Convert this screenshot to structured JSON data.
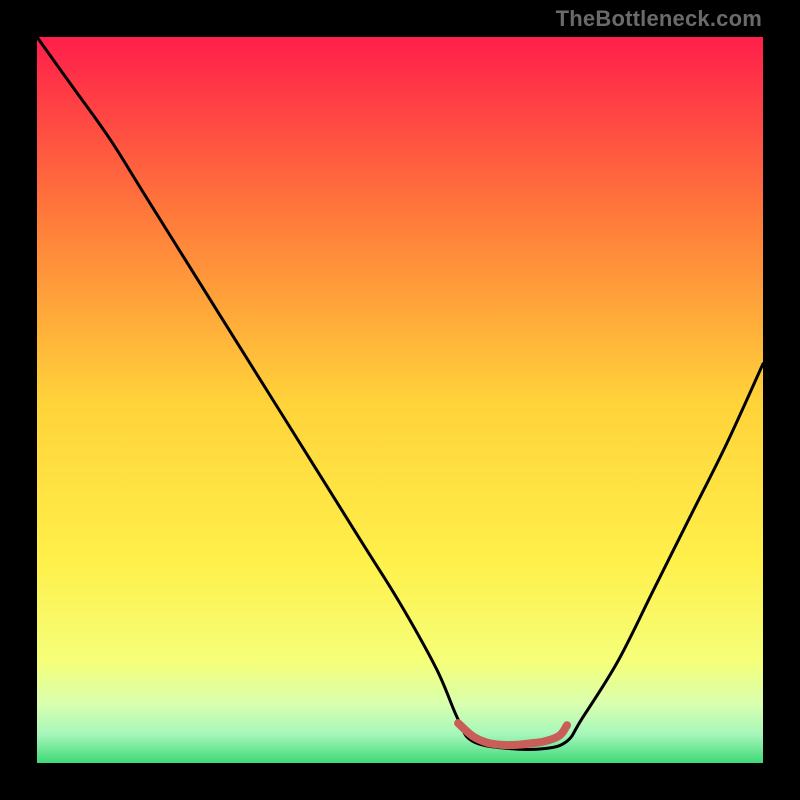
{
  "watermark": "TheBottleneck.com",
  "colors": {
    "black": "#000000",
    "curve_dark": "#000000",
    "flat_segment": "#c85e57"
  },
  "chart_data": {
    "type": "line",
    "title": "",
    "xlabel": "",
    "ylabel": "",
    "xlim": [
      0,
      100
    ],
    "ylim": [
      0,
      100
    ],
    "gradient_stops": [
      {
        "pos": 0.0,
        "color": "#ff1e4b"
      },
      {
        "pos": 0.25,
        "color": "#ff7b3a"
      },
      {
        "pos": 0.5,
        "color": "#ffd23a"
      },
      {
        "pos": 0.72,
        "color": "#fff04a"
      },
      {
        "pos": 0.86,
        "color": "#f5ff79"
      },
      {
        "pos": 0.92,
        "color": "#d8ffb0"
      },
      {
        "pos": 0.96,
        "color": "#a6f7bb"
      },
      {
        "pos": 1.0,
        "color": "#3fd977"
      }
    ],
    "series": [
      {
        "name": "bottleneck-curve",
        "x": [
          0,
          5,
          10,
          15,
          20,
          25,
          30,
          35,
          40,
          45,
          50,
          55,
          58,
          60,
          65,
          70,
          73,
          75,
          80,
          85,
          90,
          95,
          100
        ],
        "y": [
          100,
          93,
          86,
          78,
          70,
          62,
          54,
          46,
          38,
          30,
          22,
          13,
          6,
          3,
          2,
          2,
          3,
          6,
          14,
          24,
          34,
          44,
          55
        ]
      },
      {
        "name": "flat-segment",
        "x": [
          58,
          60,
          62,
          64,
          66,
          68,
          70,
          72,
          73
        ],
        "y": [
          5.5,
          3.7,
          2.8,
          2.5,
          2.5,
          2.7,
          3.0,
          3.8,
          5.2
        ]
      }
    ]
  }
}
